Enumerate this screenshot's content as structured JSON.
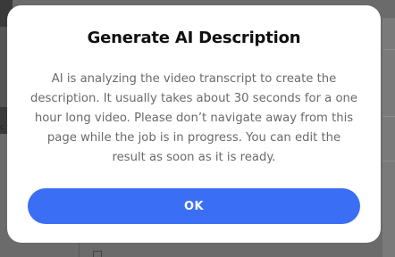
{
  "modal": {
    "title": "Generate AI Description",
    "body": "AI is analyzing the video transcript to create the description. It usually takes about 30 seconds for a one hour long video. Please don’t navigate away from this page while the job is in progress. You can edit the result as soon as it is ready.",
    "ok_label": "OK"
  },
  "background": {
    "left_label": "c"
  },
  "colors": {
    "accent": "#3a6ef5",
    "title": "#111111",
    "body_text": "#6a6a6a",
    "overlay": "#6b6b6b"
  }
}
